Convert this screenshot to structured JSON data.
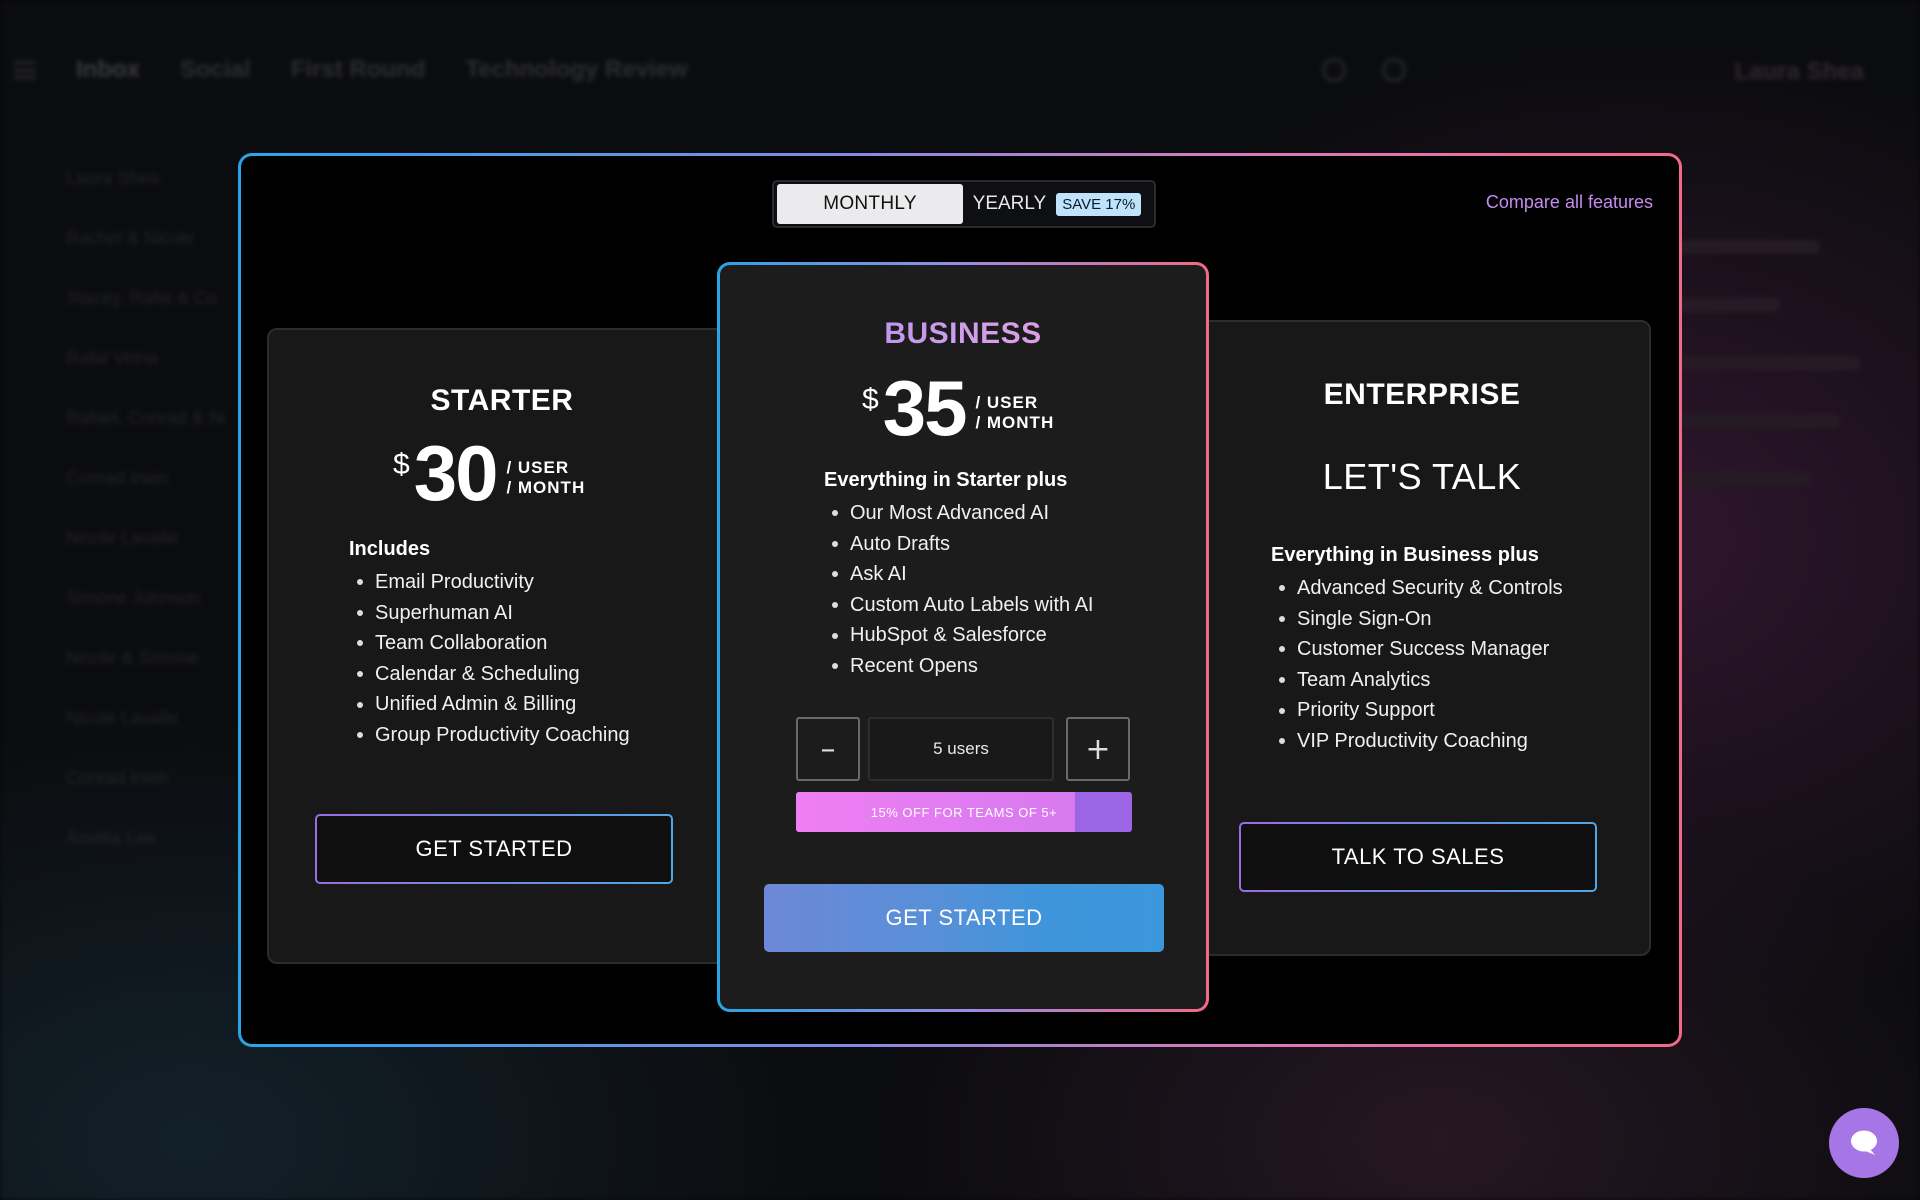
{
  "background": {
    "tabs": [
      "Inbox",
      "Social",
      "First Round",
      "Technology Review"
    ],
    "profile": "Laura Shea",
    "senders": [
      "Laura Shea",
      "Rachel & Nicole",
      "Stacey, Rafal & Co",
      "Rafal Velna",
      "Rafael, Conrad & Ni",
      "Conrad Irwin",
      "Nicole Lavalle",
      "Simone Johnson",
      "Nicole & Simone",
      "Nicole Lavalle",
      "Conrad Irwin",
      "Amelia Lee"
    ]
  },
  "billing": {
    "monthly_label": "MONTHLY",
    "yearly_label": "YEARLY",
    "save_badge": "SAVE 17%",
    "selected": "monthly"
  },
  "compare_link": "Compare all features",
  "plans": {
    "starter": {
      "name": "STARTER",
      "currency": "$",
      "price": "30",
      "unit_line1": "/ USER",
      "unit_line2": "/ MONTH",
      "features_title": "Includes",
      "features": [
        "Email Productivity",
        "Superhuman AI",
        "Team Collaboration",
        "Calendar & Scheduling",
        "Unified Admin & Billing",
        "Group Productivity Coaching"
      ],
      "cta": "GET STARTED"
    },
    "business": {
      "name": "BUSINESS",
      "currency": "$",
      "price": "35",
      "unit_line1": "/ USER",
      "unit_line2": "/ MONTH",
      "features_title": "Everything in Starter plus",
      "features": [
        "Our Most Advanced AI",
        "Auto Drafts",
        "Ask AI",
        "Custom Auto Labels with AI",
        "HubSpot & Salesforce",
        "Recent Opens"
      ],
      "users_value": "5 users",
      "minus_label": "–",
      "plus_label": "+",
      "discount_text": "15% OFF FOR TEAMS OF 5+",
      "discount_progress": 0.83,
      "cta": "GET STARTED"
    },
    "enterprise": {
      "name": "ENTERPRISE",
      "price_text": "LET'S TALK",
      "features_title": "Everything in Business plus",
      "features": [
        "Advanced Security & Controls",
        "Single Sign-On",
        "Customer Success Manager",
        "Team Analytics",
        "Priority Support",
        "VIP Productivity Coaching"
      ],
      "cta": "TALK TO SALES"
    }
  },
  "colors": {
    "accent_blue": "#2aa4e6",
    "accent_pink": "#f06a87",
    "link_purple": "#c48cf0",
    "chat_button": "#a675e6"
  },
  "icons": {
    "chat": "chat-bubble-icon",
    "menu": "hamburger-icon"
  }
}
